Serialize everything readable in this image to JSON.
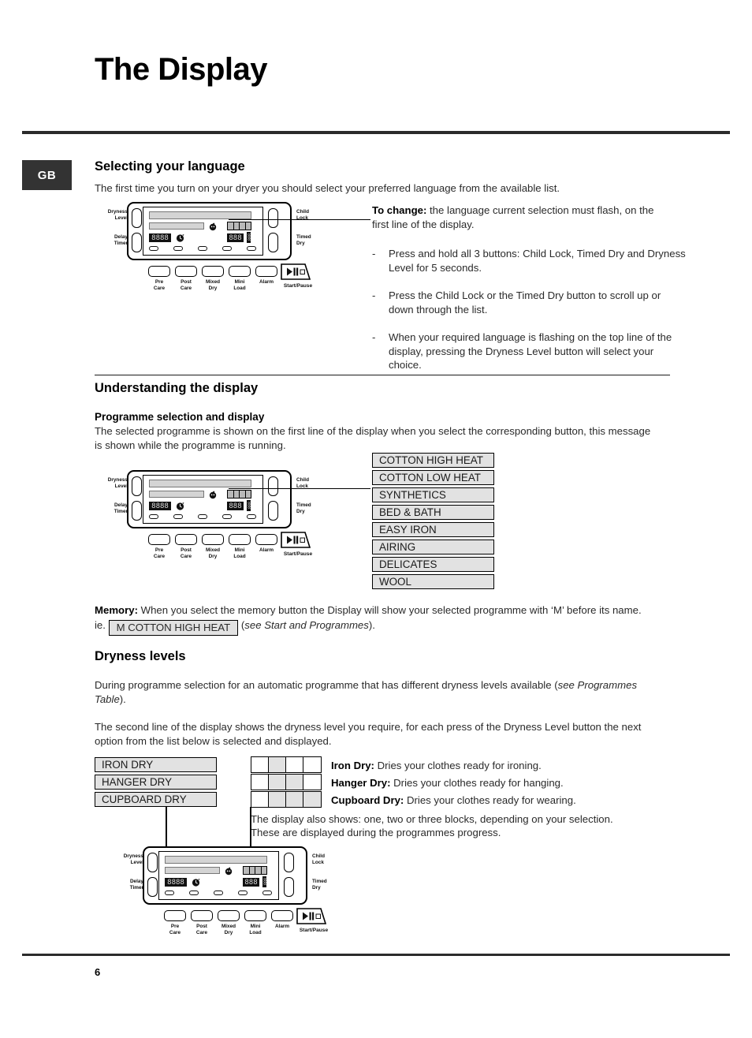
{
  "page": {
    "title": "The Display",
    "number": "6",
    "locale_badge": "GB"
  },
  "section_language": {
    "heading": "Selecting your language",
    "intro": "The first time you turn on your dryer you should select your preferred language from the available list.",
    "to_change_label": "To change:",
    "to_change_text": " the language current selection must flash, on the first line of the display.",
    "steps": [
      "Press and hold all 3 buttons: Child Lock, Timed Dry and Dryness Level for 5 seconds.",
      "Press the Child Lock or the Timed Dry button to scroll up or down through the list.",
      "When your required language is flashing on the top line of the display, pressing the Dryness Level button will select your choice."
    ],
    "dash": "-"
  },
  "section_understanding": {
    "heading": "Understanding the display",
    "subheading": "Programme selection and display",
    "paragraph": "The selected programme is shown on the first line of the display when you select the corresponding button, this message is shown while the programme is running.",
    "programmes": [
      "COTTON HIGH HEAT",
      "COTTON LOW HEAT",
      "SYNTHETICS",
      "BED & BATH",
      "EASY IRON",
      "AIRING",
      "DELICATES",
      "WOOL"
    ]
  },
  "section_memory": {
    "label": "Memory:",
    "text_before": " When you select the memory button the Display will show your selected programme with ‘M’ before its name.",
    "ie_prefix": "ie.",
    "example_box": "M  COTTON HIGH HEAT",
    "paren_open": "(",
    "italic_ref": "see Start and Programmes",
    "paren_close": ")."
  },
  "section_dryness": {
    "heading": "Dryness levels",
    "paragraph1_before": "During programme selection for an automatic programme that has different dryness levels available (",
    "paragraph1_italic": "see Programmes Table",
    "paragraph1_after": ").",
    "paragraph2": "The second line of the display shows the dryness level you require, for each press of the Dryness Level button the next option from the list below is selected and displayed.",
    "levels": [
      {
        "box": "IRON DRY",
        "term": "Iron Dry:",
        "desc": " Dries your clothes ready for ironing.",
        "blocks": [
          false,
          true,
          false,
          false
        ]
      },
      {
        "box": "HANGER DRY",
        "term": "Hanger Dry:",
        "desc": " Dries your clothes ready for hanging.",
        "blocks": [
          false,
          true,
          true,
          false
        ]
      },
      {
        "box": "CUPBOARD DRY",
        "term": "Cupboard Dry:",
        "desc": " Dries your clothes ready for wearing.",
        "blocks": [
          false,
          true,
          true,
          true
        ]
      }
    ],
    "note_line1": "The display also shows: one, two or three blocks, depending on your selection.",
    "note_line2": "These are displayed during the programmes progress."
  },
  "control_panel": {
    "left_labels": [
      {
        "line1": "Dryness",
        "line2": "Level"
      },
      {
        "line1": "Delay",
        "line2": "Timer"
      }
    ],
    "right_labels": [
      {
        "line1": "Child",
        "line2": "Lock"
      },
      {
        "line1": "Timed",
        "line2": "Dry"
      }
    ],
    "function_buttons": [
      {
        "line1": "Pre",
        "line2": "Care"
      },
      {
        "line1": "Post",
        "line2": "Care"
      },
      {
        "line1": "Mixed",
        "line2": "Dry"
      },
      {
        "line1": "Mini",
        "line2": "Load"
      },
      {
        "line1": "Alarm",
        "line2": ""
      }
    ],
    "start_pause_label": "Start/Pause",
    "lcd": {
      "segment_4digit": "8888",
      "segment_3digit": "888",
      "segment_mini": "888",
      "block_states": [
        true,
        true,
        true,
        true
      ],
      "baby_icon": "child-lock-icon",
      "clock_icon": "delay-timer-icon"
    }
  }
}
